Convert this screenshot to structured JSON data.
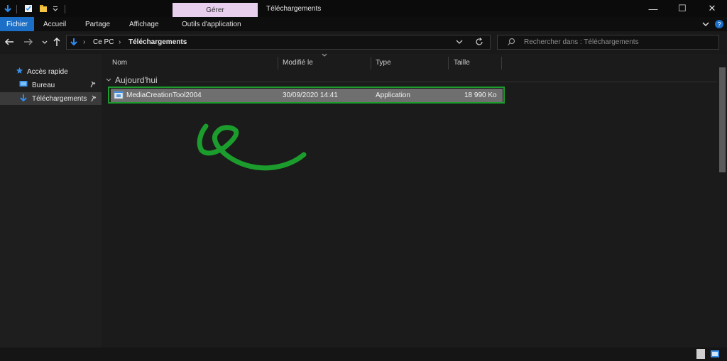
{
  "window": {
    "title": "Téléchargements",
    "contextual_tab": "Gérer"
  },
  "ribbon": {
    "tabs": [
      "Fichier",
      "Accueil",
      "Partage",
      "Affichage",
      "Outils d'application"
    ]
  },
  "address": {
    "root": "Ce PC",
    "current": "Téléchargements",
    "separator": "›"
  },
  "search": {
    "placeholder": "Rechercher dans : Téléchargements"
  },
  "sidebar": {
    "items": [
      {
        "label": "Accès rapide"
      },
      {
        "label": "Bureau"
      },
      {
        "label": "Téléchargements"
      }
    ]
  },
  "columns": [
    "Nom",
    "Modifié le",
    "Type",
    "Taille"
  ],
  "group": {
    "label": "Aujourd'hui"
  },
  "files": [
    {
      "name": "MediaCreationTool2004",
      "modified": "30/09/2020 14:41",
      "type": "Application",
      "size": "18 990 Ko"
    }
  ],
  "colors": {
    "accent": "#1b6fc6",
    "highlight": "#1b9c2c",
    "contextual": "#e9cfee",
    "background": "#1b1b1b"
  }
}
